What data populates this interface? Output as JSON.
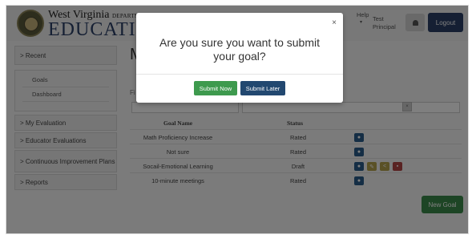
{
  "header": {
    "brand_line1": "West Virginia",
    "brand_line1_small": "DEPARTMENT",
    "brand_line2": "EDUCATION",
    "help_label": "Help",
    "help_caret": "▾",
    "user_name": "Test Principal",
    "logout_label": "Logout"
  },
  "sidebar": {
    "recent_label": "> Recent",
    "recent_items": [
      "Goals",
      "Dashboard"
    ],
    "items": [
      "> My Evaluation",
      "> Educator Evaluations",
      "> Continuous Improvement Plans",
      "> Reports"
    ]
  },
  "main": {
    "page_title_initial": "M",
    "filter_label_initial": "Fi",
    "table": {
      "columns": [
        "Goal Name",
        "Status"
      ],
      "rows": [
        {
          "name": "Math Proficiency Increase",
          "status": "Rated"
        },
        {
          "name": "Not sure",
          "status": "Rated"
        },
        {
          "name": "Socail-Emotional Learning",
          "status": "Draft"
        },
        {
          "name": "10-minute meetings",
          "status": "Rated"
        }
      ]
    },
    "new_goal_label": "New Goal"
  },
  "modal": {
    "close_glyph": "×",
    "message": "Are you sure you want to submit your goal?",
    "submit_now_label": "Submit Now",
    "submit_later_label": "Submit Later"
  },
  "colors": {
    "brand_navy": "#2a3f66",
    "submit_now": "#3e9a4e",
    "submit_later": "#224870",
    "new_goal": "#3b8a4a",
    "delete": "#b24545"
  },
  "icons": {
    "view": "eye-icon",
    "edit": "pencil-icon",
    "share": "share-icon",
    "delete": "trash-icon",
    "bell": "bell-icon"
  }
}
